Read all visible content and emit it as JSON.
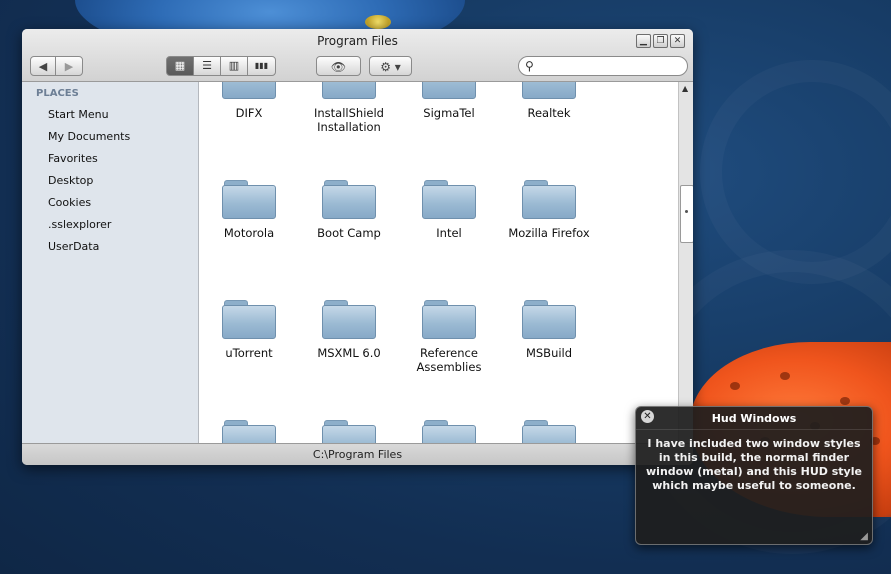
{
  "window": {
    "title": "Program Files",
    "status_path": "C:\\Program Files",
    "controls": {
      "minimize": "▁",
      "maximize": "❐",
      "close": "✕"
    }
  },
  "toolbar": {
    "back_icon": "◀",
    "forward_icon": "▶",
    "view_icons": "▦",
    "view_list": "☰",
    "view_columns": "▥",
    "view_coverflow": "▮▮▮",
    "quicklook_icon": "👁",
    "action_icon": "⚙ ▾",
    "search_placeholder": ""
  },
  "sidebar": {
    "header": "PLACES",
    "items": [
      {
        "label": "Start Menu"
      },
      {
        "label": "My Documents"
      },
      {
        "label": "Favorites"
      },
      {
        "label": "Desktop"
      },
      {
        "label": "Cookies"
      },
      {
        "label": ".sslexplorer"
      },
      {
        "label": "UserData"
      }
    ]
  },
  "folders": [
    {
      "label": "DIFX"
    },
    {
      "label": "InstallShield Installation"
    },
    {
      "label": "SigmaTel"
    },
    {
      "label": "Realtek"
    },
    {
      "label": "Motorola"
    },
    {
      "label": "Boot Camp"
    },
    {
      "label": "Intel"
    },
    {
      "label": "Mozilla Firefox"
    },
    {
      "label": "uTorrent"
    },
    {
      "label": "MSXML 6.0"
    },
    {
      "label": "Reference Assemblies"
    },
    {
      "label": "MSBuild"
    }
  ],
  "hud": {
    "title": "Hud Windows",
    "close_icon": "✕",
    "body": "I have included two window styles in this build, the normal finder window (metal) and this HUD style which maybe useful to someone.",
    "resize_icon": "◢"
  },
  "colors": {
    "desktop": "#16325a",
    "sidebar_bg": "#dfe5ec",
    "places_header": "#6d7f95",
    "hud_bg": "#1e1e1e"
  }
}
